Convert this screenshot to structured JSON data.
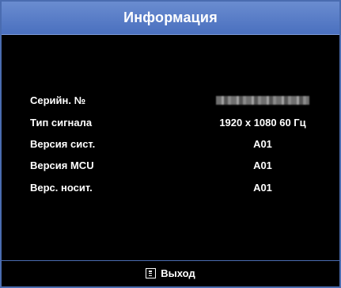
{
  "window": {
    "title": "Информация"
  },
  "info": {
    "rows": [
      {
        "label": "Серийн. №",
        "value": "",
        "value_style": "blurred"
      },
      {
        "label": "Тип сигнала",
        "value": "1920 x 1080 60 Гц"
      },
      {
        "label": "Версия сист.",
        "value": "A01"
      },
      {
        "label": "Версия MCU",
        "value": "A01"
      },
      {
        "label": "Верс. носит.",
        "value": "A01"
      }
    ]
  },
  "footer": {
    "icon": "menu-icon",
    "exit_label": "Выход"
  },
  "colors": {
    "background": "#000000",
    "title_bar": "#5a7ec8",
    "border": "#4a6cb0",
    "text": "#ffffff"
  }
}
